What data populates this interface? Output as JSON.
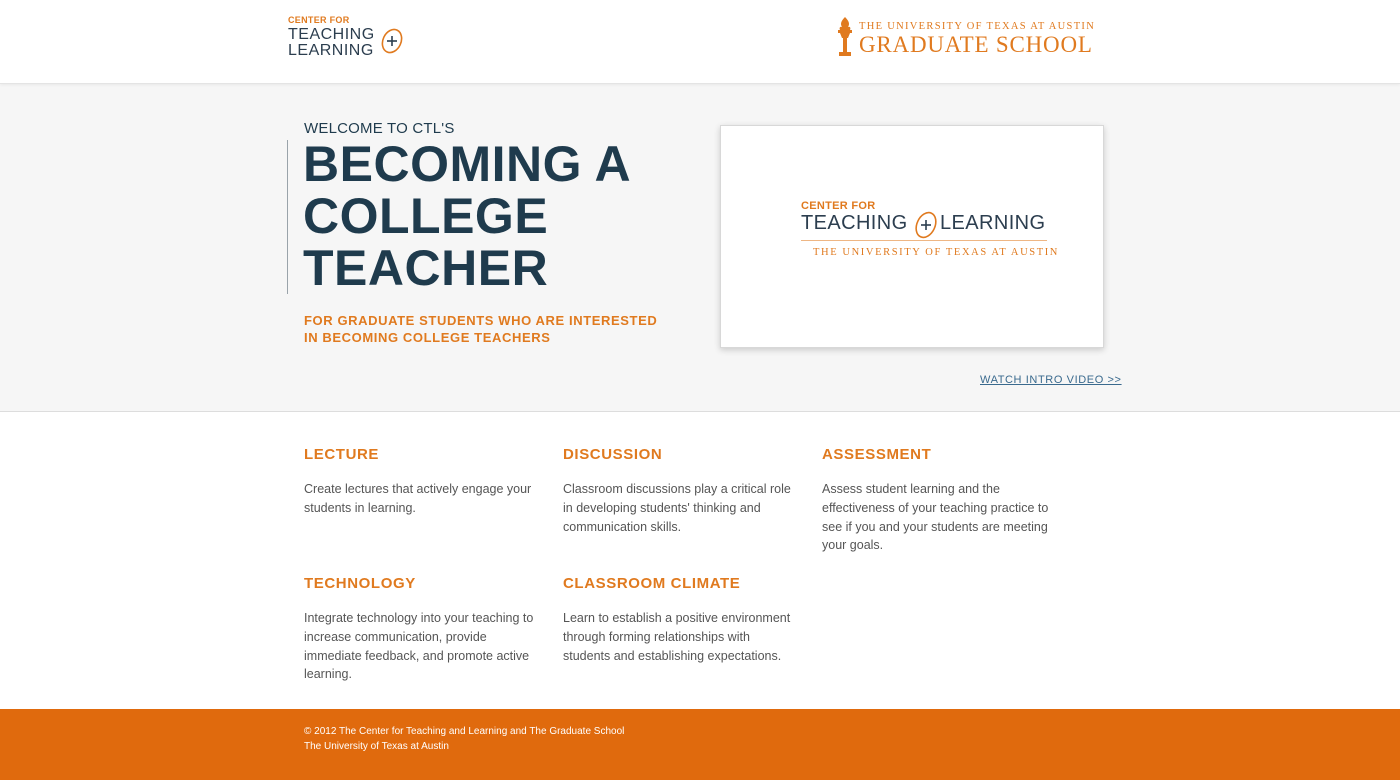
{
  "header": {
    "ctl_logo": {
      "small": "CENTER FOR",
      "line1": "TEACHING",
      "line2": "LEARNING"
    },
    "gs_logo": {
      "top": "THE UNIVERSITY OF TEXAS AT AUSTIN",
      "big": "GRADUATE SCHOOL"
    }
  },
  "hero": {
    "welcome": "WELCOME TO CTL'S",
    "title_lines": [
      "BECOMING A",
      "COLLEGE",
      "TEACHER"
    ],
    "tagline": "FOR GRADUATE STUDENTS WHO ARE INTERESTED IN BECOMING COLLEGE TEACHERS",
    "video_logo": {
      "small": "CENTER FOR",
      "left": "TEACHING",
      "right": "LEARNING",
      "university": "THE UNIVERSITY OF TEXAS AT AUSTIN"
    },
    "watch_link": "WATCH INTRO VIDEO >>"
  },
  "topics": [
    {
      "title": "LECTURE",
      "text": "Create lectures that actively engage your students in learning."
    },
    {
      "title": "DISCUSSION",
      "text": "Classroom discussions play a critical role in developing students' thinking and communication skills."
    },
    {
      "title": "ASSESSMENT",
      "text": "Assess student learning and the effectiveness of your teaching practice to see if you and your students are meeting your goals."
    },
    {
      "title": "TECHNOLOGY",
      "text": "Integrate technology into your teaching to increase communication, provide immediate feedback, and promote active learning."
    },
    {
      "title": "CLASSROOM CLIMATE",
      "text": "Learn to establish a positive environment through forming relationships with students and establishing expectations."
    }
  ],
  "footer": {
    "line1": "© 2012 The Center for Teaching and Learning and The Graduate School",
    "line2": "The University of Texas at Austin"
  },
  "colors": {
    "accent": "#e07a1f",
    "navy": "#1f3b4d",
    "footer": "#e06a0d",
    "link": "#3a6a8e"
  },
  "icons": [
    "plus-circle-icon",
    "torch-icon"
  ]
}
